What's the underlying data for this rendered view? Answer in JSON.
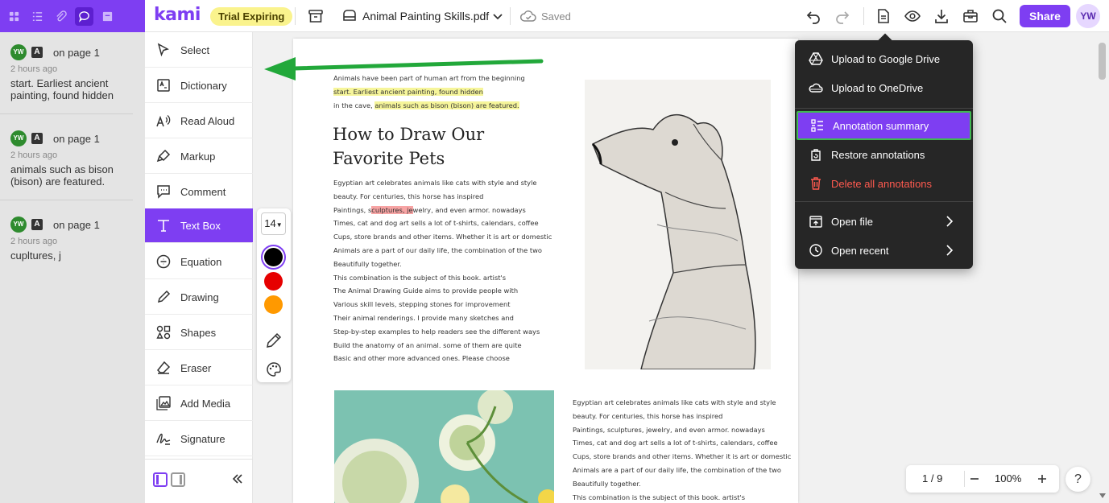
{
  "header": {
    "logo": "kami",
    "trial_badge": "Trial Expiring",
    "file_name": "Animal Painting Skills.pdf",
    "save_status": "Saved",
    "share_label": "Share",
    "user_initials": "YW",
    "panel_icons": [
      "apps-grid-icon",
      "outline-list-icon",
      "attachment-icon",
      "comments-icon",
      "thumbnails-icon"
    ],
    "toolbar_icons": [
      "undo-icon",
      "redo-icon",
      "document-menu-icon",
      "view-icon",
      "download-icon",
      "toolbox-icon",
      "search-icon"
    ]
  },
  "comments": [
    {
      "initials": "YW",
      "page": "on page 1",
      "time": "2 hours ago",
      "text": "start. Earliest ancient painting, found hidden"
    },
    {
      "initials": "YW",
      "page": "on page 1",
      "time": "2 hours ago",
      "text": "animals such as bison (bison) are featured."
    },
    {
      "initials": "YW",
      "page": "on page 1",
      "time": "2 hours ago",
      "text": "cupltures, j"
    }
  ],
  "tools": [
    {
      "label": "Select",
      "icon": "cursor-icon"
    },
    {
      "label": "Dictionary",
      "icon": "dictionary-icon"
    },
    {
      "label": "Read Aloud",
      "icon": "read-aloud-icon"
    },
    {
      "label": "Markup",
      "icon": "highlighter-icon"
    },
    {
      "label": "Comment",
      "icon": "comment-icon"
    },
    {
      "label": "Text Box",
      "icon": "text-icon",
      "active": true
    },
    {
      "label": "Equation",
      "icon": "equation-icon"
    },
    {
      "label": "Drawing",
      "icon": "pen-icon"
    },
    {
      "label": "Shapes",
      "icon": "shapes-icon"
    },
    {
      "label": "Eraser",
      "icon": "eraser-icon"
    },
    {
      "label": "Add Media",
      "icon": "media-icon"
    },
    {
      "label": "Signature",
      "icon": "signature-icon"
    }
  ],
  "textbox_options": {
    "font_size": "14",
    "colors": [
      "#000000",
      "#e60000",
      "#ff9900"
    ],
    "selected_color": "#000000"
  },
  "document": {
    "intro_lines": [
      "Animals have been part of human art from the beginning",
      "start. Earliest ancient painting, found hidden",
      "in the cave, animals such as bison (bison) are featured."
    ],
    "title_line1": "How to Draw Our",
    "title_line2": "Favorite Pets",
    "body_lines": [
      "Egyptian art celebrates animals like cats with style and style",
      "beauty. For centuries, this horse has inspired",
      "Paintings, sculptures, jewelry, and even armor. nowadays",
      "Times, cat and dog art sells a lot of t-shirts, calendars, coffee",
      "Cups, store brands and other items. Whether it is art or domestic",
      "Animals are a part of our daily life, the combination of the two",
      "Beautifully together.",
      "This combination is the subject of this book. artist's",
      "The Animal Drawing Guide aims to provide people with",
      "Various skill levels, stepping stones for improvement",
      "Their animal renderings. I provide many sketches and",
      "Step-by-step examples to help readers see the different ways",
      "Build the anatomy of an animal. some of them are quite",
      "Basic and other more advanced ones. Please choose"
    ],
    "second_col_lines": [
      "Egyptian art celebrates animals like cats with style and style",
      "beauty. For centuries, this horse has inspired",
      "Paintings, sculptures, jewelry, and even armor. nowadays",
      "Times, cat and dog art sells a lot of t-shirts, calendars, coffee",
      "Cups, store brands and other items. Whether it is art or domestic",
      "Animals are a part of our daily life, the combination of the two",
      "Beautifully together.",
      "This combination is the subject of this book. artist's"
    ]
  },
  "menu": [
    {
      "label": "Upload to Google Drive",
      "icon": "google-drive-icon"
    },
    {
      "label": "Upload to OneDrive",
      "icon": "onedrive-icon"
    },
    {
      "label": "Annotation summary",
      "icon": "annotation-summary-icon",
      "highlighted": true
    },
    {
      "label": "Restore annotations",
      "icon": "restore-icon"
    },
    {
      "label": "Delete all annotations",
      "icon": "trash-icon",
      "danger": true
    },
    {
      "label": "Open file",
      "icon": "open-file-icon",
      "submenu": true
    },
    {
      "label": "Open recent",
      "icon": "clock-icon",
      "submenu": true
    }
  ],
  "zoom": {
    "page_indicator": "1 / 9",
    "zoom_level": "100%",
    "help": "?"
  },
  "colors": {
    "brand": "#7e3ef2",
    "highlight_yellow": "#f6f59a",
    "highlight_red": "#f7a4a4",
    "arrow": "#22a83a",
    "menu_bg": "#262626"
  }
}
